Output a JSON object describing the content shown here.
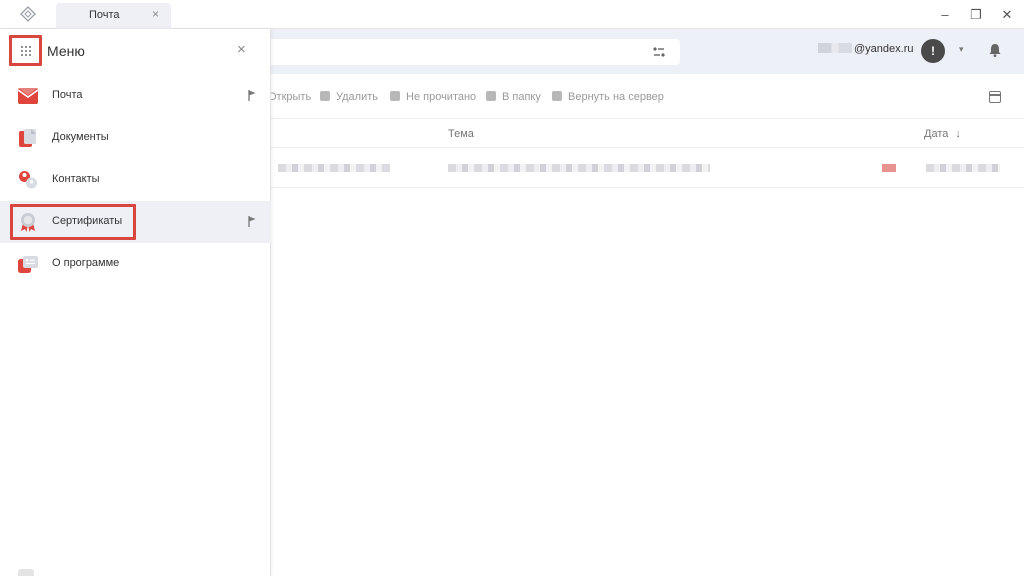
{
  "titlebar": {
    "tab_label": "Почта",
    "tab_close": "×",
    "minimize": "–",
    "restore": "❐",
    "close": "✕"
  },
  "header": {
    "account_suffix": "@yandex.ru",
    "warning_glyph": "!",
    "caret": "▾"
  },
  "toolbar": {
    "actions": [
      {
        "label": "Открыть",
        "icon": "open-icon"
      },
      {
        "label": "Удалить",
        "icon": "trash-icon"
      },
      {
        "label": "Не прочитано",
        "icon": "envelope-open-icon"
      },
      {
        "label": "В папку",
        "icon": "folder-icon"
      },
      {
        "label": "Вернуть на сервер",
        "icon": "return-server-icon"
      }
    ]
  },
  "list": {
    "columns": {
      "subject": "Тема",
      "date": "Дата",
      "sort_glyph": "↓"
    }
  },
  "menu": {
    "title": "Меню",
    "close_glyph": "×",
    "items": [
      {
        "label": "Почта",
        "icon": "mail-icon",
        "has_flag": true,
        "active": false
      },
      {
        "label": "Документы",
        "icon": "documents-icon",
        "has_flag": false,
        "active": false
      },
      {
        "label": "Контакты",
        "icon": "contacts-icon",
        "has_flag": false,
        "active": false
      },
      {
        "label": "Сертификаты",
        "icon": "certificate-icon",
        "has_flag": true,
        "active": true
      },
      {
        "label": "О программе",
        "icon": "about-icon",
        "has_flag": false,
        "active": false
      }
    ]
  },
  "colors": {
    "accent_red": "#d9463f",
    "header_bg": "#eef0f7",
    "active_row": "#eef0f5"
  }
}
